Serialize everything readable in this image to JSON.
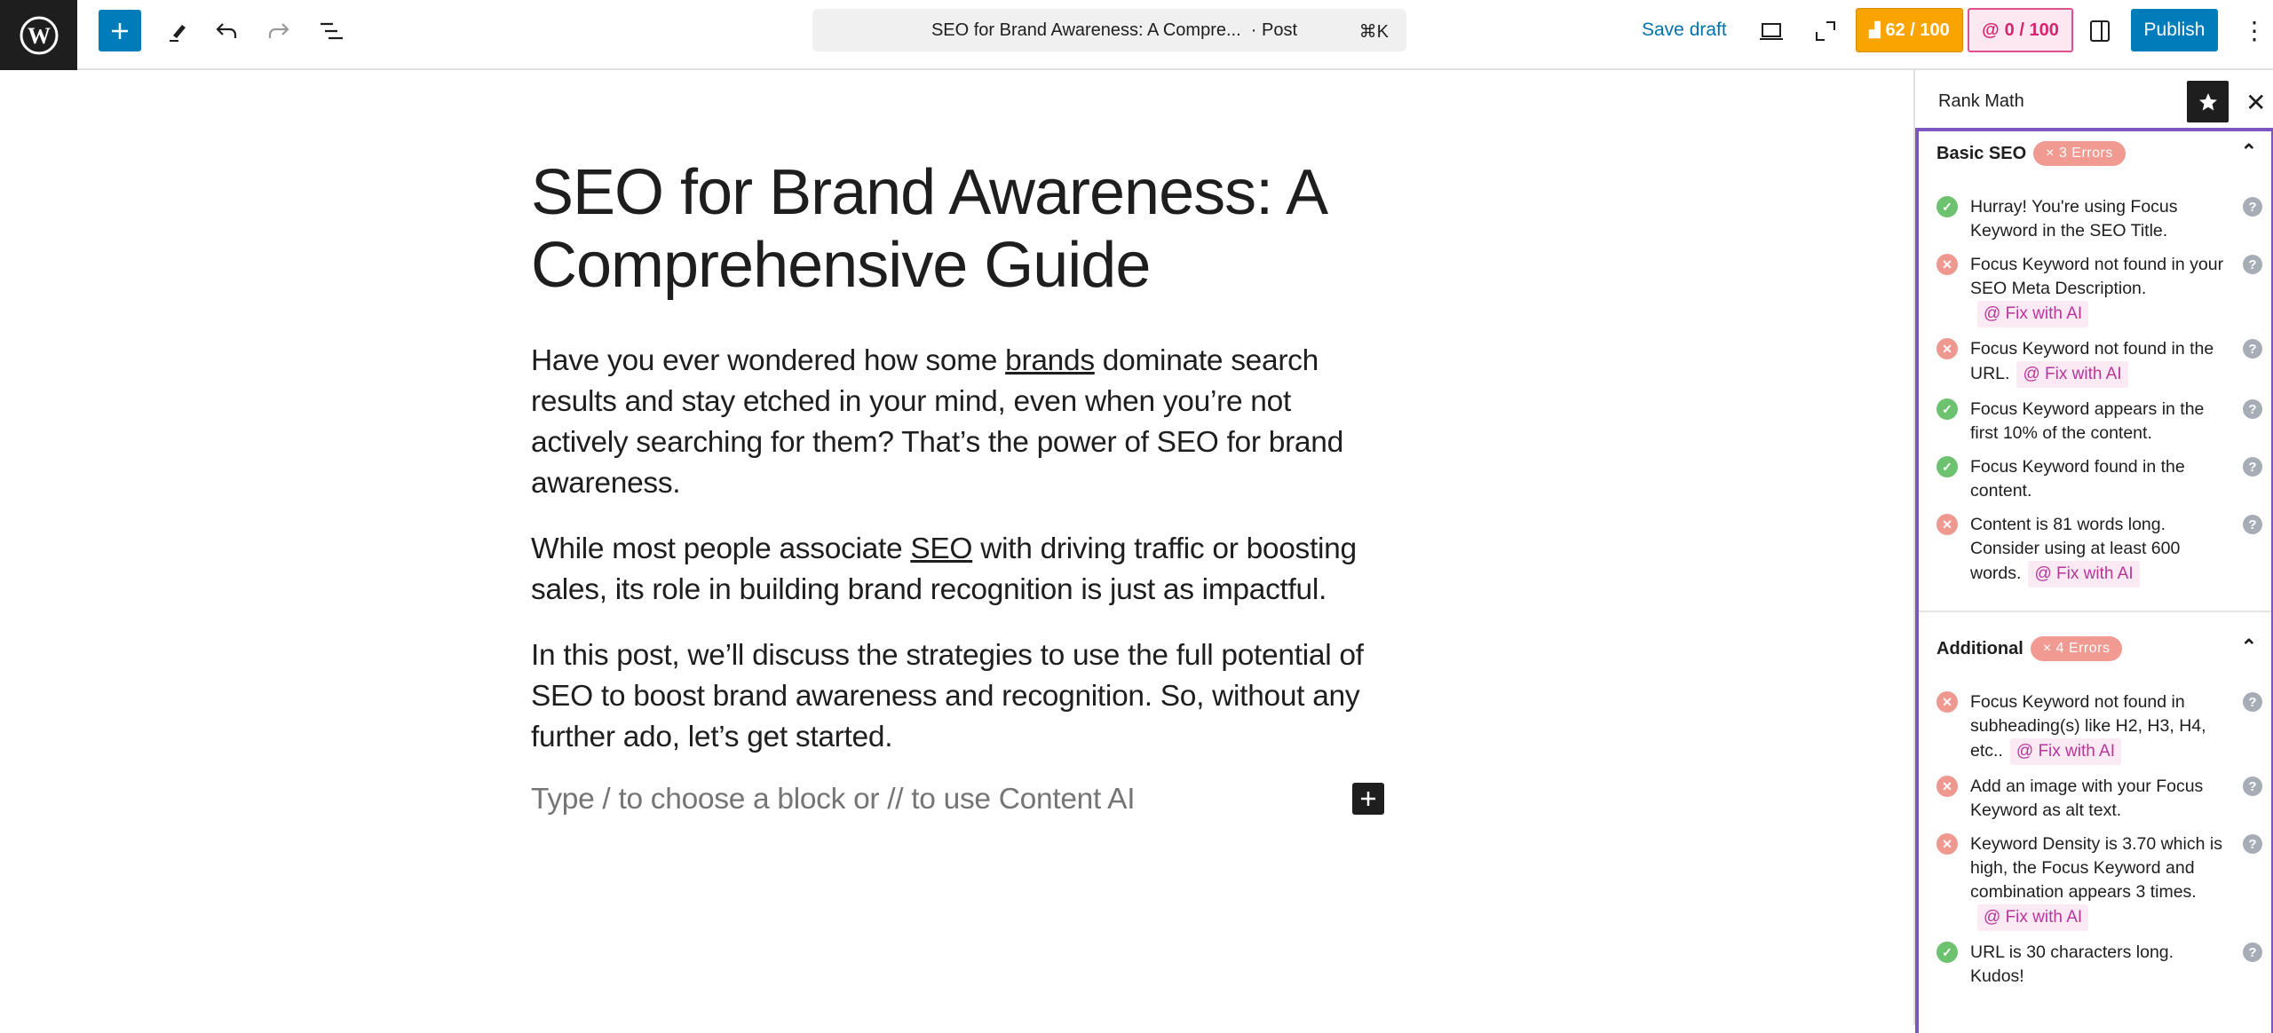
{
  "topbar": {
    "document_title": "SEO for Brand Awareness: A Compre...",
    "post_type": "· Post",
    "shortcut": "⌘K",
    "save_draft": "Save draft",
    "seo_score": "62 / 100",
    "content_ai_score": "0 / 100",
    "publish": "Publish"
  },
  "editor": {
    "title": "SEO for Brand Awareness: A Comprehensive Guide",
    "p1_before": "Have you ever wondered how some ",
    "p1_link": "brands",
    "p1_after": " dominate search results and stay etched in your mind, even when you’re not actively searching for them? That’s the power of SEO for brand awareness.",
    "p2_before": "While most people associate ",
    "p2_link": "SEO",
    "p2_after": " with driving traffic or boosting sales, its role in building brand recognition is just as impactful.",
    "p3": "In this post, we’ll discuss the strategies to use the full potential of SEO to boost brand awareness and recognition. So, without any further ado, let’s get started.",
    "placeholder": "Type / to choose a block or // to use Content AI"
  },
  "sidebar": {
    "title": "Rank Math",
    "fix_label": "Fix with AI",
    "sections": [
      {
        "title": "Basic SEO",
        "badge": "× 3 Errors",
        "items": [
          {
            "status": "ok",
            "text": "Hurray! You're using Focus Keyword in the SEO Title."
          },
          {
            "status": "error",
            "text": "Focus Keyword not found in your SEO Meta Description.",
            "fix": true
          },
          {
            "status": "error",
            "text": "Focus Keyword not found in the URL.",
            "fix": true
          },
          {
            "status": "ok",
            "text": "Focus Keyword appears in the first 10% of the content."
          },
          {
            "status": "ok",
            "text": "Focus Keyword found in the content."
          },
          {
            "status": "error",
            "text": "Content is 81 words long. Consider using at least 600 words.",
            "fix": true
          }
        ]
      },
      {
        "title": "Additional",
        "badge": "× 4 Errors",
        "items": [
          {
            "status": "error",
            "text": "Focus Keyword not found in subheading(s) like H2, H3, H4, etc..",
            "fix": true
          },
          {
            "status": "error",
            "text": "Add an image with your Focus Keyword as alt text."
          },
          {
            "status": "error",
            "text": "Keyword Density is 3.70 which is high, the Focus Keyword and combination appears 3 times.",
            "fix": true
          },
          {
            "status": "ok",
            "text": "URL is 30 characters long. Kudos!"
          }
        ]
      }
    ]
  },
  "colors": {
    "accent": "#007cba",
    "seo_score_bg": "#f9a400",
    "panel_border": "#7d57c1",
    "ok": "#6cc26e",
    "error": "#ee9890"
  }
}
